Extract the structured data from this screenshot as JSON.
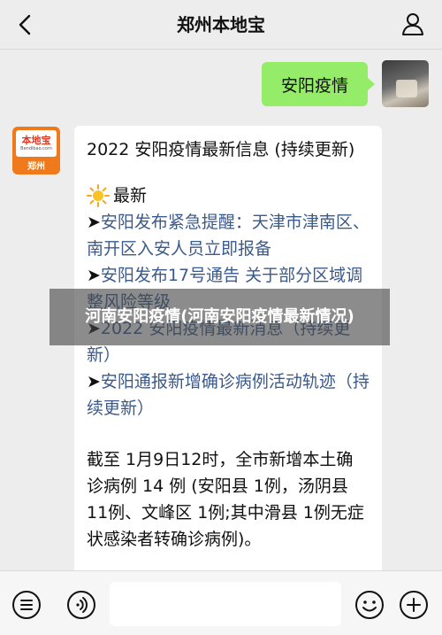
{
  "header": {
    "title": "郑州本地宝",
    "back_icon": "chevron-left-icon",
    "profile_icon": "person-icon"
  },
  "outgoing": {
    "text": "安阳疫情"
  },
  "bot": {
    "logo_name": "本地宝",
    "logo_url": "Bendibao.com",
    "logo_city": "郑州"
  },
  "message": {
    "title": "2022 安阳疫情最新信息 (持续更新)",
    "latest_label": "最新",
    "items": [
      {
        "arrow": "➤",
        "text": "安阳发布紧急提醒：天津市津南区、南开区入安人员立即报备"
      },
      {
        "arrow": "➤",
        "text": "安阳发布17号通告 关于部分区域调整风险等级"
      },
      {
        "arrow": "➤",
        "text": "2022 安阳疫情最新消息（持续更新）"
      },
      {
        "arrow": "➤",
        "text": "安阳通报新增确诊病例活动轨迹（持续更新）"
      }
    ],
    "summary": "截至 1月9日12时，全市新增本土确诊病例 14 例 (安阳县 1例，汤阴县 11例、文峰区 1例;其中滑县 1例无症状感染者转确诊病例)。"
  },
  "overlay": {
    "text": "河南安阳疫情(河南安阳疫情最新情况)"
  },
  "inputbar": {
    "menu_icon": "menu-list-icon",
    "voice_icon": "voice-icon",
    "emoji_icon": "emoji-icon",
    "plus_icon": "plus-icon"
  },
  "colors": {
    "outgoing_bubble": "#95ec69",
    "link": "#3b5a8c",
    "brand_orange": "#f07a1b"
  }
}
